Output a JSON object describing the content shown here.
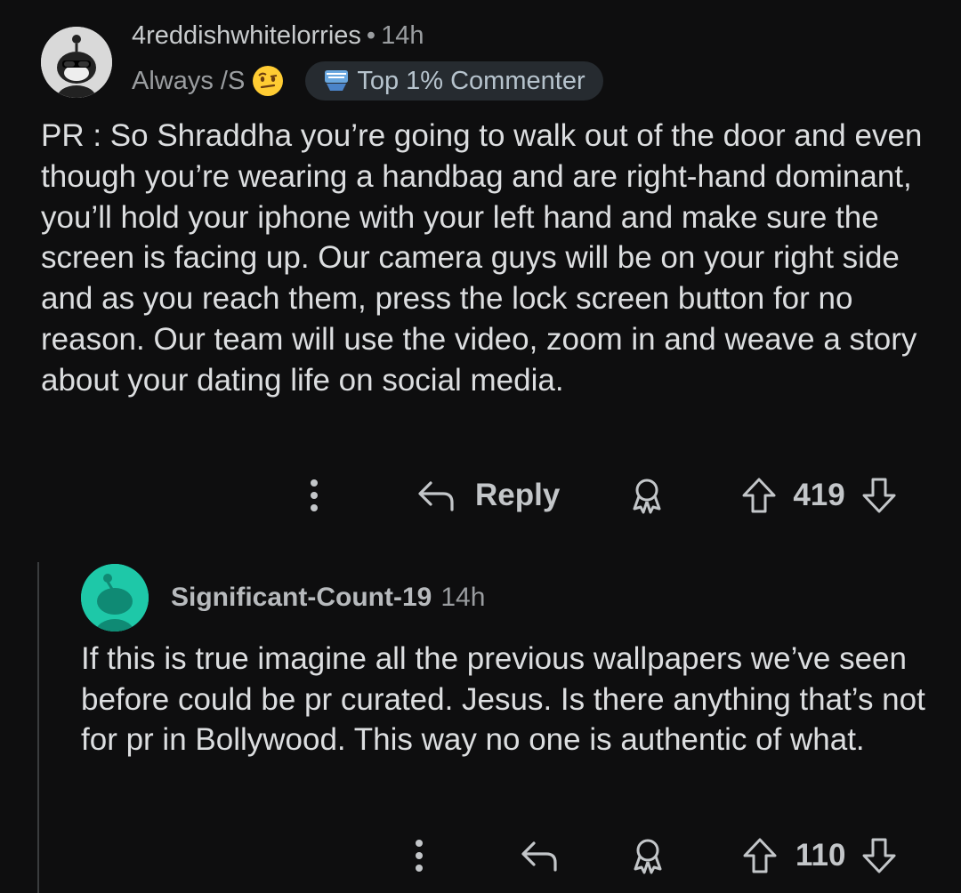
{
  "main_comment": {
    "username": "4reddishwhitelorries",
    "separator": "•",
    "time": "14h",
    "flair": "Always /S",
    "flair_emoji": "raised-eyebrow-emoji",
    "badge": "Top 1% Commenter",
    "body": "PR : So Shraddha you’re going to walk out of the door and even though you’re wearing a handbag and are right-hand dominant, you’ll hold your iphone with your left hand and make sure the screen is facing up. Our camera guys will be on your right side and as you reach them, press the lock screen button for no reason. Our team will use the video, zoom in and weave a story about your dating life on social media.",
    "actions": {
      "reply_label": "Reply",
      "score": "419"
    }
  },
  "reply_comment": {
    "username": "Significant-Count-19",
    "time": "14h",
    "body": "If this is true imagine all the previous wallpapers we’ve seen before could be pr curated. Jesus. Is there anything that’s not for pr in Bollywood. This way no one is authentic of what.",
    "actions": {
      "score": "110"
    }
  },
  "colors": {
    "background": "#0e0e0f",
    "text": "#dcdee0",
    "muted": "#9a9da0",
    "badge_bg": "#262b30",
    "reply_avatar": "#1ec8a8"
  }
}
